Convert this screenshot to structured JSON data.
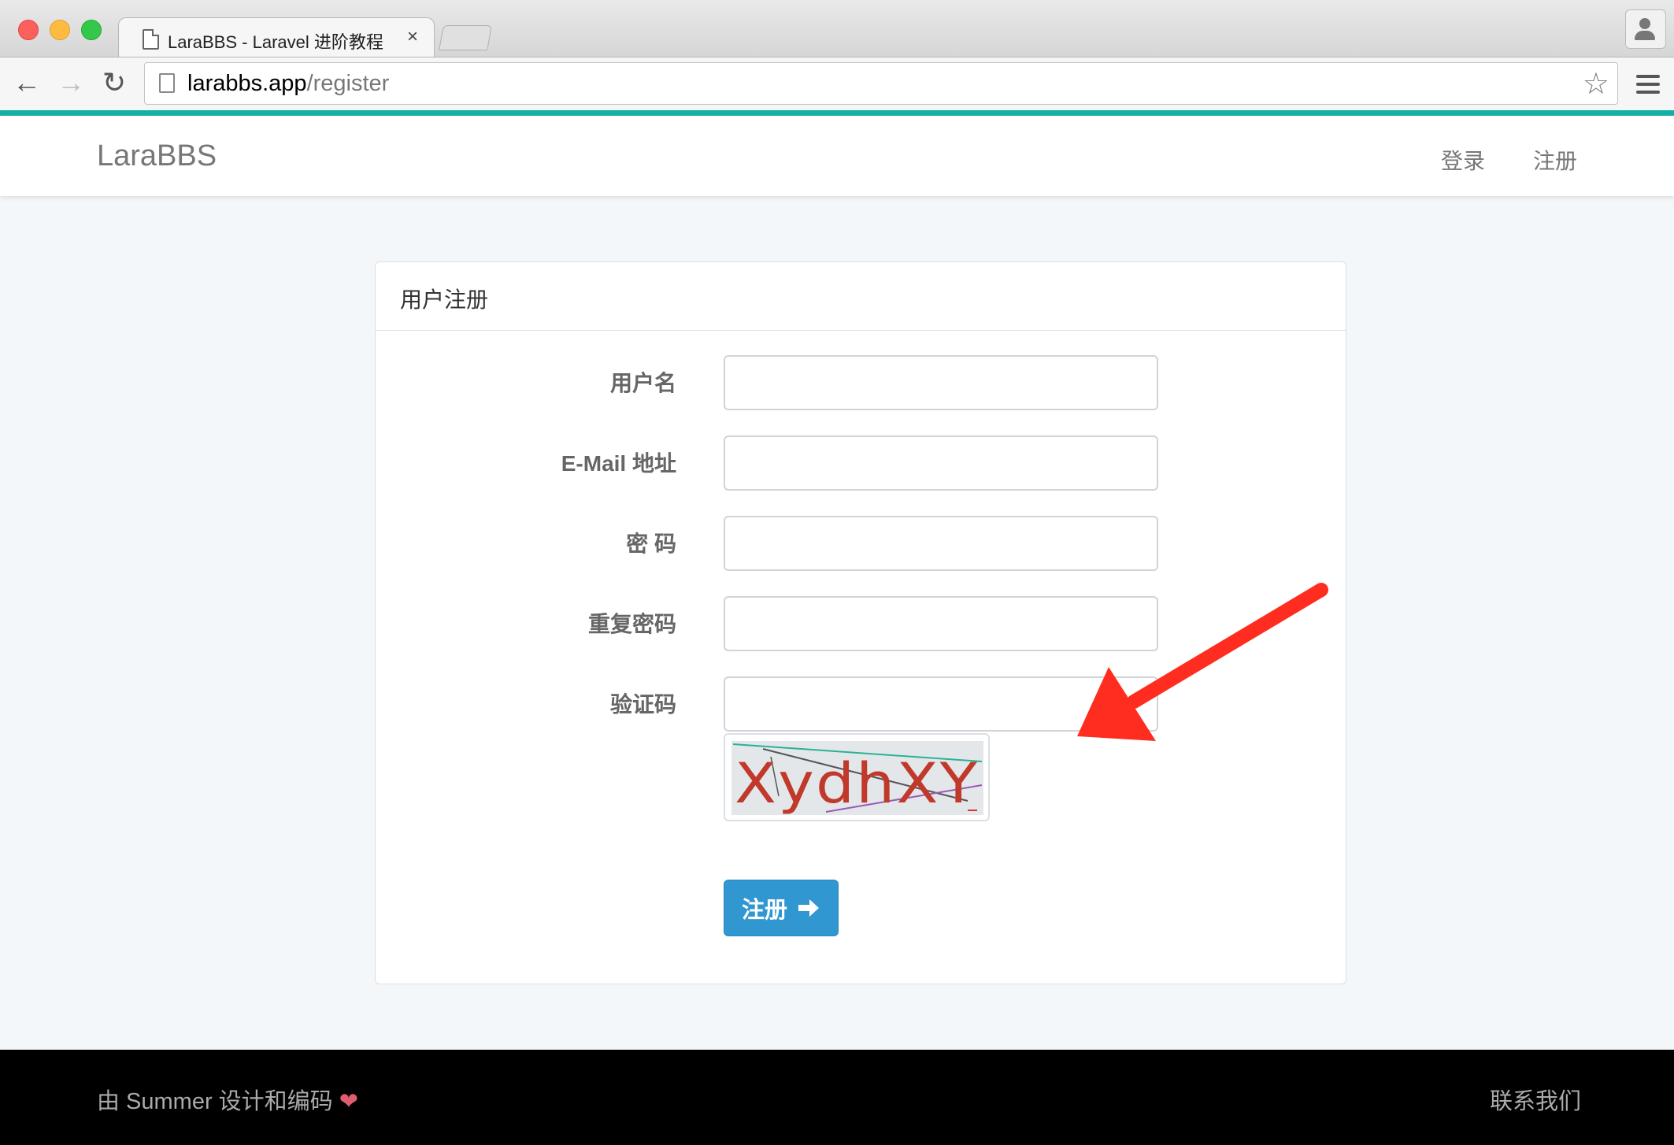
{
  "browser": {
    "tab_title": "LaraBBS - Laravel 进阶教程",
    "tab_close": "×",
    "url_host": "larabbs.app",
    "url_path": "/register",
    "bookmark_icon": "star-icon"
  },
  "site": {
    "brand": "LaraBBS",
    "nav": {
      "login": "登录",
      "register": "注册"
    }
  },
  "panel": {
    "title": "用户注册",
    "fields": {
      "username": {
        "label": "用户名",
        "value": ""
      },
      "email": {
        "label": "E-Mail 地址",
        "value": ""
      },
      "password": {
        "label": "密 码",
        "value": ""
      },
      "password_confirm": {
        "label": "重复密码",
        "value": ""
      },
      "captcha": {
        "label": "验证码",
        "value": ""
      }
    },
    "captcha_text": "XydhXY",
    "submit": {
      "label": "注册",
      "icon": "arrow-right-icon"
    }
  },
  "footer": {
    "credit": "由 Summer 设计和编码",
    "heart": "❤",
    "contact": "联系我们"
  },
  "colors": {
    "accent": "#3097d1",
    "teal": "#13b1a5",
    "annotation_arrow": "#ff2d1f"
  }
}
